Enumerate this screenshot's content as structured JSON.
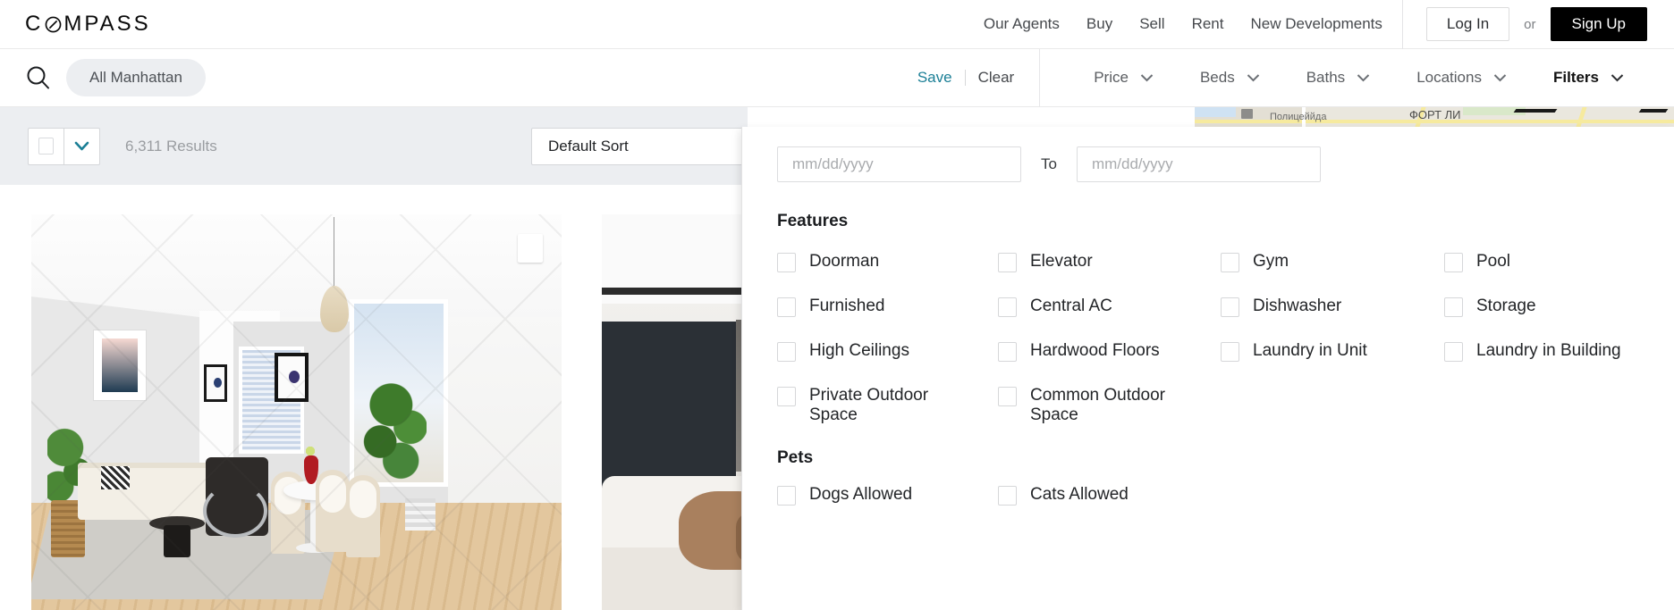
{
  "brand": {
    "name": "COMPASS"
  },
  "topnav": {
    "links": [
      {
        "label": "Our Agents",
        "name": "nav-our-agents"
      },
      {
        "label": "Buy",
        "name": "nav-buy"
      },
      {
        "label": "Sell",
        "name": "nav-sell"
      },
      {
        "label": "Rent",
        "name": "nav-rent"
      },
      {
        "label": "New Developments",
        "name": "nav-new-developments"
      }
    ],
    "login_label": "Log In",
    "or_label": "or",
    "signup_label": "Sign Up"
  },
  "searchbar": {
    "icon": "search-icon",
    "location_pill": "All Manhattan",
    "save_label": "Save",
    "clear_label": "Clear",
    "save_color": "#1b7f96"
  },
  "filters": {
    "items": [
      {
        "label": "Price",
        "active": false
      },
      {
        "label": "Beds",
        "active": false
      },
      {
        "label": "Baths",
        "active": false
      },
      {
        "label": "Locations",
        "active": false
      },
      {
        "label": "Filters",
        "active": true
      }
    ]
  },
  "results": {
    "count_label": "6,311 Results",
    "sort_label": "Default Sort",
    "select_all_checkbox": "",
    "chevron_color": "#1b7f96"
  },
  "map": {
    "labels": [
      "Полицеййда",
      "ФОРТ ЛИ"
    ]
  },
  "panel": {
    "date_from_placeholder": "mm/dd/yyyy",
    "date_to_placeholder": "mm/dd/yyyy",
    "date_from_value": "",
    "date_to_value": "",
    "to_label": "To",
    "features_title": "Features",
    "features": [
      "Doorman",
      "Elevator",
      "Gym",
      "Pool",
      "Furnished",
      "Central AC",
      "Dishwasher",
      "Storage",
      "High Ceilings",
      "Hardwood Floors",
      "Laundry in Unit",
      "Laundry in Building",
      "Private Outdoor Space",
      "Common Outdoor Space"
    ],
    "pets_title": "Pets",
    "pets": [
      "Dogs Allowed",
      "Cats Allowed"
    ]
  },
  "listings": [
    {
      "name": "listing-card-1",
      "alt": "Living and dining room interior"
    },
    {
      "name": "listing-card-2",
      "alt": "Bedroom and kitchen interior"
    }
  ]
}
